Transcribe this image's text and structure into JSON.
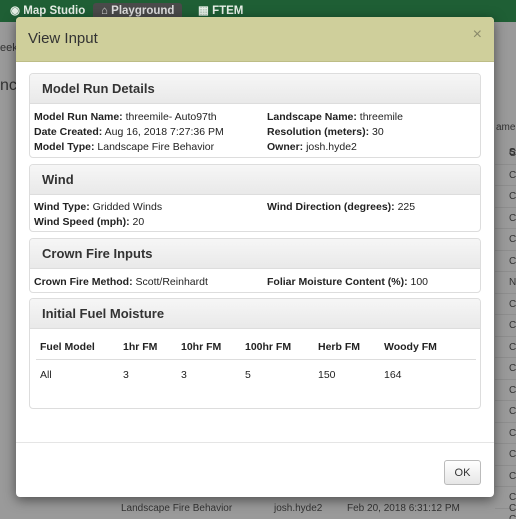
{
  "nav": {
    "items": [
      {
        "label": "Map Studio",
        "icon": "globe-icon"
      },
      {
        "label": "Playground",
        "icon": "home-icon"
      },
      {
        "label": "FTEM",
        "icon": "calculator-icon"
      }
    ]
  },
  "background": {
    "left_fragments": [
      "eek",
      "nc"
    ],
    "right_header": "ame",
    "right_col_header": "S",
    "right_col": [
      "C",
      "C",
      "C",
      "C",
      "C",
      "C",
      "N",
      "C",
      "C",
      "C",
      "C",
      "C",
      "C",
      "C",
      "C",
      "C",
      "C",
      "C"
    ],
    "bottom_row": {
      "model_type": "Landscape Fire Behavior",
      "owner": "josh.hyde2",
      "date": "Feb 20, 2018 6:31:12 PM",
      "status": "C"
    }
  },
  "modal": {
    "title": "View Input",
    "close_glyph": "×",
    "ok_label": "OK",
    "model_run": {
      "heading": "Model Run Details",
      "rows": [
        {
          "label": "Model Run Name:",
          "value": "threemile- Auto97th"
        },
        {
          "label": "Landscape Name:",
          "value": "threemile"
        },
        {
          "label": "Date Created:",
          "value": "Aug 16, 2018 7:27:36 PM"
        },
        {
          "label": "Resolution (meters):",
          "value": "30"
        },
        {
          "label": "Model Type:",
          "value": "Landscape Fire Behavior"
        },
        {
          "label": "Owner:",
          "value": "josh.hyde2"
        }
      ]
    },
    "wind": {
      "heading": "Wind",
      "rows": [
        {
          "label": "Wind Type:",
          "value": "Gridded Winds"
        },
        {
          "label": "Wind Direction (degrees):",
          "value": "225"
        },
        {
          "label": "Wind Speed (mph):",
          "value": "20"
        }
      ]
    },
    "crown": {
      "heading": "Crown Fire Inputs",
      "rows": [
        {
          "label": "Crown Fire Method:",
          "value": "Scott/Reinhardt"
        },
        {
          "label": "Foliar Moisture Content (%):",
          "value": "100"
        }
      ]
    },
    "fuel": {
      "heading": "Initial Fuel Moisture",
      "columns": [
        "Fuel Model",
        "1hr FM",
        "10hr FM",
        "100hr FM",
        "Herb FM",
        "Woody FM"
      ],
      "rows": [
        [
          "All",
          "3",
          "3",
          "5",
          "150",
          "164"
        ]
      ]
    }
  }
}
